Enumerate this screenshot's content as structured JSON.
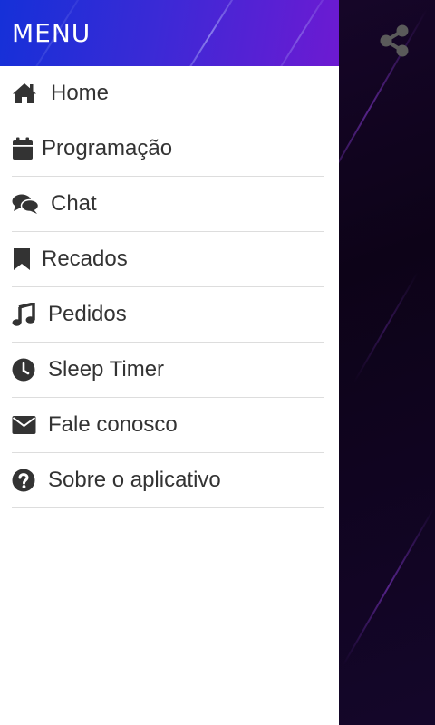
{
  "drawer": {
    "title": "MENU",
    "items": [
      {
        "label": "Home",
        "icon": "home-icon"
      },
      {
        "label": "Programação",
        "icon": "calendar-icon"
      },
      {
        "label": "Chat",
        "icon": "chat-icon"
      },
      {
        "label": "Recados",
        "icon": "bookmark-icon"
      },
      {
        "label": "Pedidos",
        "icon": "music-icon"
      },
      {
        "label": "Sleep Timer",
        "icon": "clock-icon"
      },
      {
        "label": "Fale conosco",
        "icon": "envelope-icon"
      },
      {
        "label": "Sobre o aplicativo",
        "icon": "question-icon"
      }
    ]
  },
  "toolbar": {
    "share_icon": "share-icon"
  },
  "colors": {
    "header_start": "#1530d8",
    "header_end": "#6d1ad2",
    "background": "#0d0318",
    "text": "#333333",
    "divider": "#dddddd",
    "share_icon": "#5a5a5a"
  }
}
